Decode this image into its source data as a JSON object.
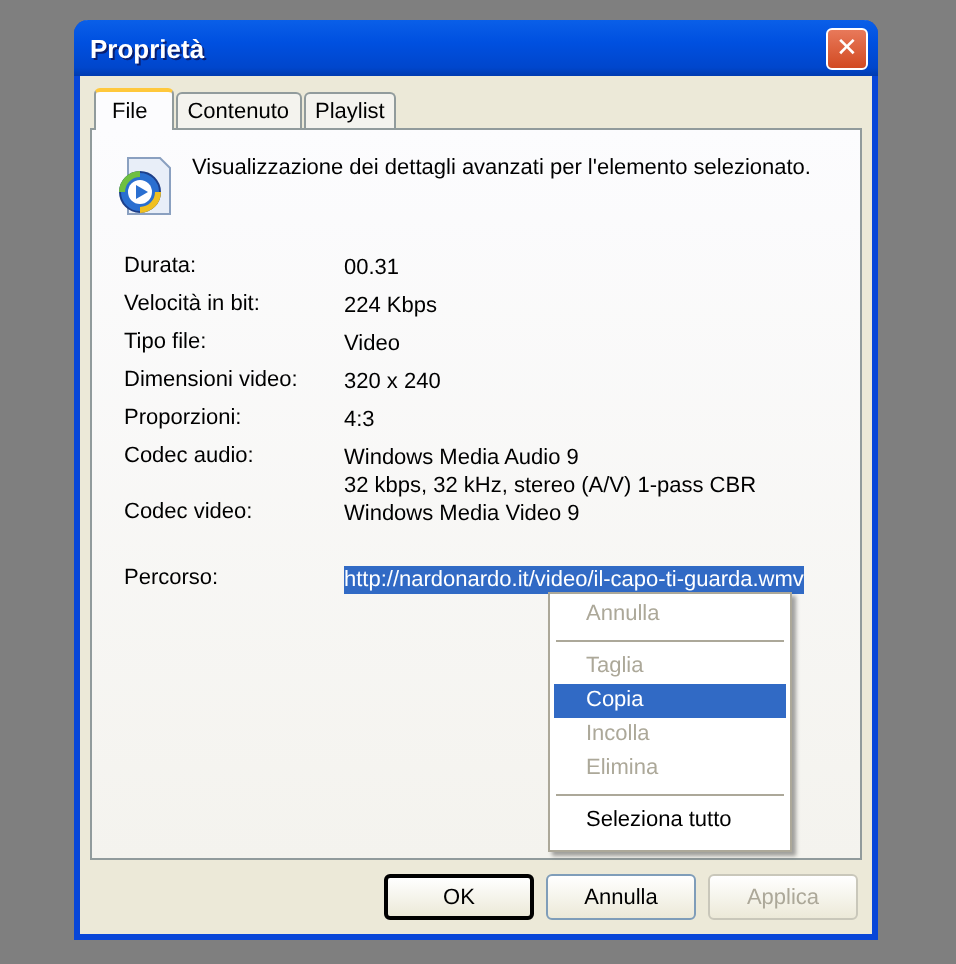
{
  "window": {
    "title": "Proprietà",
    "close": "✕"
  },
  "tabs": [
    {
      "label": "File",
      "selected": true
    },
    {
      "label": "Contenuto",
      "selected": false
    },
    {
      "label": "Playlist",
      "selected": false
    }
  ],
  "description": "Visualizzazione dei dettagli avanzati per l'elemento selezionato.",
  "rows": [
    {
      "kind": "info",
      "label": "Durata:",
      "lines": [
        "00.31"
      ],
      "highlighted": false
    },
    {
      "kind": "info",
      "label": "Velocità in bit:",
      "lines": [
        "224 Kbps"
      ],
      "highlighted": false
    },
    {
      "kind": "info",
      "label": "Tipo file:",
      "lines": [
        "Video"
      ],
      "highlighted": false
    },
    {
      "kind": "info",
      "label": "Dimensioni video:",
      "lines": [
        "320 x 240"
      ],
      "highlighted": false
    },
    {
      "kind": "info",
      "label": "Proporzioni:",
      "lines": [
        "4:3"
      ],
      "highlighted": false
    },
    {
      "kind": "info",
      "label": "Codec audio:",
      "lines": [
        "Windows Media Audio 9",
        "32 kbps, 32 kHz, stereo (A/V) 1-pass CBR"
      ],
      "highlighted": false
    },
    {
      "kind": "info",
      "label": "Codec video:",
      "lines": [
        "Windows Media Video 9"
      ],
      "highlighted": false
    },
    {
      "kind": "path",
      "label": "Percorso:",
      "lines": [
        "http://nardonardo.it/video/il-capo-ti-guarda.wmv"
      ],
      "highlighted": true
    }
  ],
  "context_menu": [
    {
      "kind": "item",
      "label": "Annulla",
      "disabled": true,
      "selected": false
    },
    {
      "kind": "separator"
    },
    {
      "kind": "item",
      "label": "Taglia",
      "disabled": true,
      "selected": false
    },
    {
      "kind": "item",
      "label": "Copia",
      "disabled": false,
      "selected": true
    },
    {
      "kind": "item",
      "label": "Incolla",
      "disabled": true,
      "selected": false
    },
    {
      "kind": "item",
      "label": "Elimina",
      "disabled": true,
      "selected": false
    },
    {
      "kind": "separator"
    },
    {
      "kind": "item",
      "label": "Seleziona tutto",
      "disabled": false,
      "selected": false
    }
  ],
  "buttons": [
    {
      "label": "OK",
      "default": true,
      "disabled": false
    },
    {
      "label": "Annulla",
      "default": false,
      "disabled": false
    },
    {
      "label": "Applica",
      "default": false,
      "disabled": true
    }
  ]
}
